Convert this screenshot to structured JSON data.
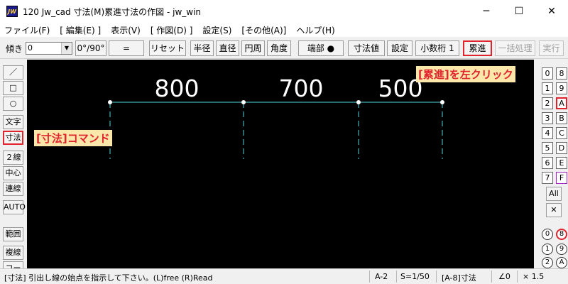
{
  "window": {
    "app_icon_label": "JW",
    "title": "120 Jw_cad 寸法(M)累進寸法の作図 - jw_win",
    "minimize_glyph": "─",
    "maximize_glyph": "☐",
    "close_glyph": "✕"
  },
  "menu": [
    "ファイル(F)",
    "[ 編集(E) ]",
    "表示(V)",
    "[ 作図(D) ]",
    "設定(S)",
    "[その他(A)]",
    "ヘルプ(H)"
  ],
  "toolbar": {
    "tilt_label": "傾き",
    "tilt_value": "0",
    "angle_button": "0°/90°",
    "equals_button": "=",
    "reset_button": "リセット",
    "radius_button": "半径",
    "diameter_button": "直径",
    "circumference_button": "円周",
    "angle_dim_button": "角度",
    "endpoint_button": "端部 ●",
    "dim_value_button": "寸法値",
    "settings_button": "設定",
    "decimals_button": "小数桁 1",
    "cumulative_button": "累進",
    "batch_button": "一括処理",
    "execute_button": "実行"
  },
  "left_tools": [
    "／",
    "□",
    "○",
    "文字",
    "寸法",
    "２線",
    "中心線",
    "連線",
    "AUTO",
    "範囲",
    "複線",
    "コーナー"
  ],
  "right_panel": {
    "layer_rows": [
      {
        "group": "0",
        "layer": "8",
        "layer_hl": false
      },
      {
        "group": "1",
        "layer": "9",
        "layer_hl": false
      },
      {
        "group": "2",
        "layer": "A",
        "layer_hl": true
      },
      {
        "group": "3",
        "layer": "B",
        "layer_hl": false
      },
      {
        "group": "4",
        "layer": "C",
        "layer_hl": false
      },
      {
        "group": "5",
        "layer": "D",
        "layer_hl": false
      },
      {
        "group": "6",
        "layer": "E",
        "layer_hl": false
      },
      {
        "group": "7",
        "layer": "F",
        "layer_hl": false
      }
    ],
    "all_button": "All",
    "cross_button": "✕",
    "circle_rows": [
      {
        "left": "0",
        "right": "8",
        "right_hl": true
      },
      {
        "left": "1",
        "right": "9",
        "right_hl": false
      },
      {
        "left": "2",
        "right": "A",
        "right_hl": false
      }
    ]
  },
  "drawing": {
    "dimension_values": [
      "800",
      "700",
      "500"
    ],
    "line_color": "#4fd8e0"
  },
  "callouts": {
    "cumulative_hint": "[累進]を左クリック",
    "dimension_hint": "[寸法]コマンド",
    "highlight_color": "#e0232d"
  },
  "status": {
    "message": "[寸法] 引出し線の始点を指示して下さい。(L)free  (R)Read",
    "layer": "A-2",
    "scale": "S=1/50",
    "layer_name": "[A-8]寸法",
    "angle": "∠0",
    "zoom": "× 1.5"
  }
}
